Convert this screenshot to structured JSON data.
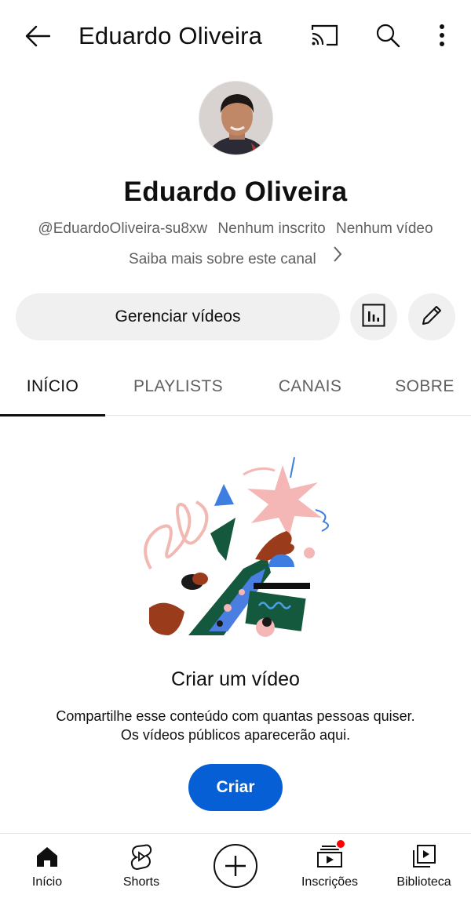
{
  "header": {
    "title": "Eduardo Oliveira"
  },
  "channel": {
    "name": "Eduardo Oliveira",
    "handle": "@EduardoOliveira-su8xw",
    "subscribers": "Nenhum inscrito",
    "videos": "Nenhum vídeo",
    "about_link": "Saiba mais sobre este canal"
  },
  "actions": {
    "manage_videos": "Gerenciar vídeos"
  },
  "tabs": [
    {
      "label": "INÍCIO",
      "active": true
    },
    {
      "label": "PLAYLISTS",
      "active": false
    },
    {
      "label": "CANAIS",
      "active": false
    },
    {
      "label": "SOBRE",
      "active": false
    }
  ],
  "empty_state": {
    "title": "Criar um vídeo",
    "line1": "Compartilhe esse conteúdo com quantas pessoas quiser.",
    "line2": "Os vídeos públicos aparecerão aqui.",
    "button": "Criar"
  },
  "bottom_nav": [
    {
      "label": "Início",
      "icon": "home-icon"
    },
    {
      "label": "Shorts",
      "icon": "shorts-icon"
    },
    {
      "label": "",
      "icon": "create-plus-icon"
    },
    {
      "label": "Inscrições",
      "icon": "subscriptions-icon"
    },
    {
      "label": "Biblioteca",
      "icon": "library-icon"
    }
  ],
  "colors": {
    "accent": "#065fd4",
    "notification": "#ff0000",
    "text": "#0f0f0f",
    "secondary_text": "#606060",
    "chip_bg": "#f0f0f0"
  }
}
